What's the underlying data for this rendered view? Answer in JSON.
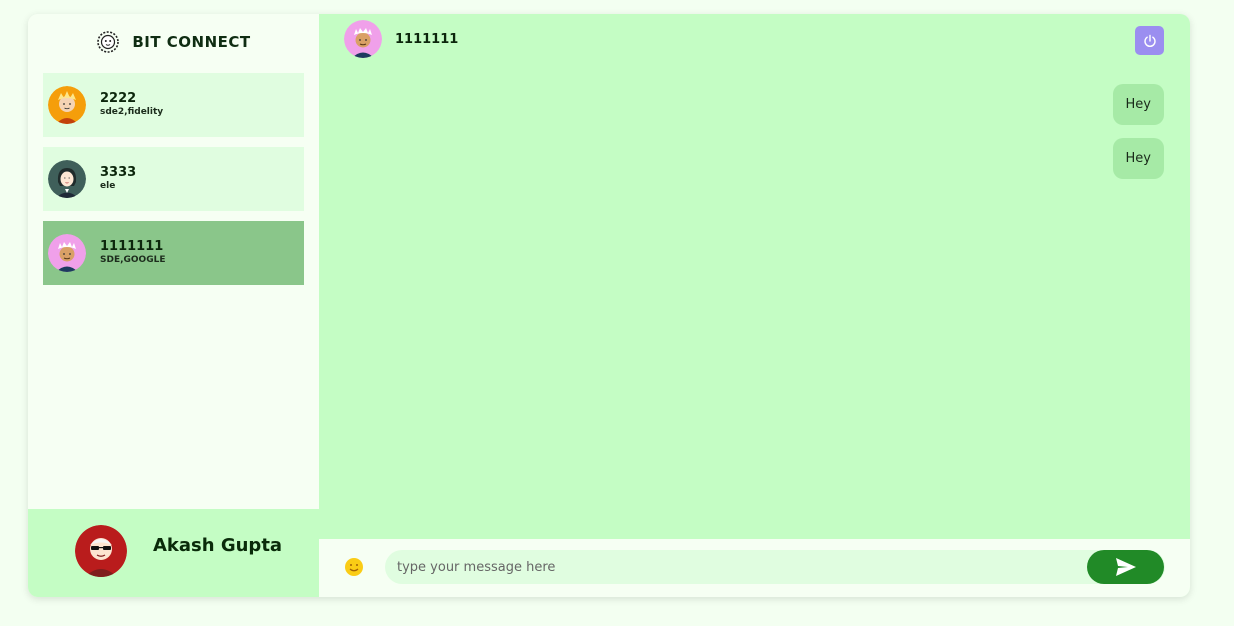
{
  "brand": {
    "name": "BIT CONNECT",
    "icon": "lion-logo-icon"
  },
  "contacts": [
    {
      "name": "2222",
      "subtitle": "sde2,fidelity",
      "avatar": "avatar-blonde",
      "active": false
    },
    {
      "name": "3333",
      "subtitle": "ele",
      "avatar": "avatar-dark-hair",
      "active": false
    },
    {
      "name": "1111111",
      "subtitle": "SDE,GOOGLE",
      "avatar": "avatar-white-hair",
      "active": true
    }
  ],
  "current_user": {
    "name": "Akash Gupta",
    "avatar": "avatar-sunglasses"
  },
  "chat": {
    "header_name": "1111111",
    "power_icon": "power-icon",
    "messages": [
      {
        "text": "Hey"
      },
      {
        "text": "Hey"
      }
    ]
  },
  "composer": {
    "placeholder": "type your message here",
    "emoji_icon": "emoji-icon",
    "send_icon": "send-icon"
  },
  "colors": {
    "page_bg": "#f3fff1",
    "sidebar_bg": "#f6fff3",
    "chat_bg": "#c4fdc4",
    "contact_bg": "#e0fde0",
    "contact_active_bg": "#8ac68a",
    "bubble_bg": "#a6eaa6",
    "send_button": "#218a27",
    "power_button": "#9b8ef0"
  }
}
